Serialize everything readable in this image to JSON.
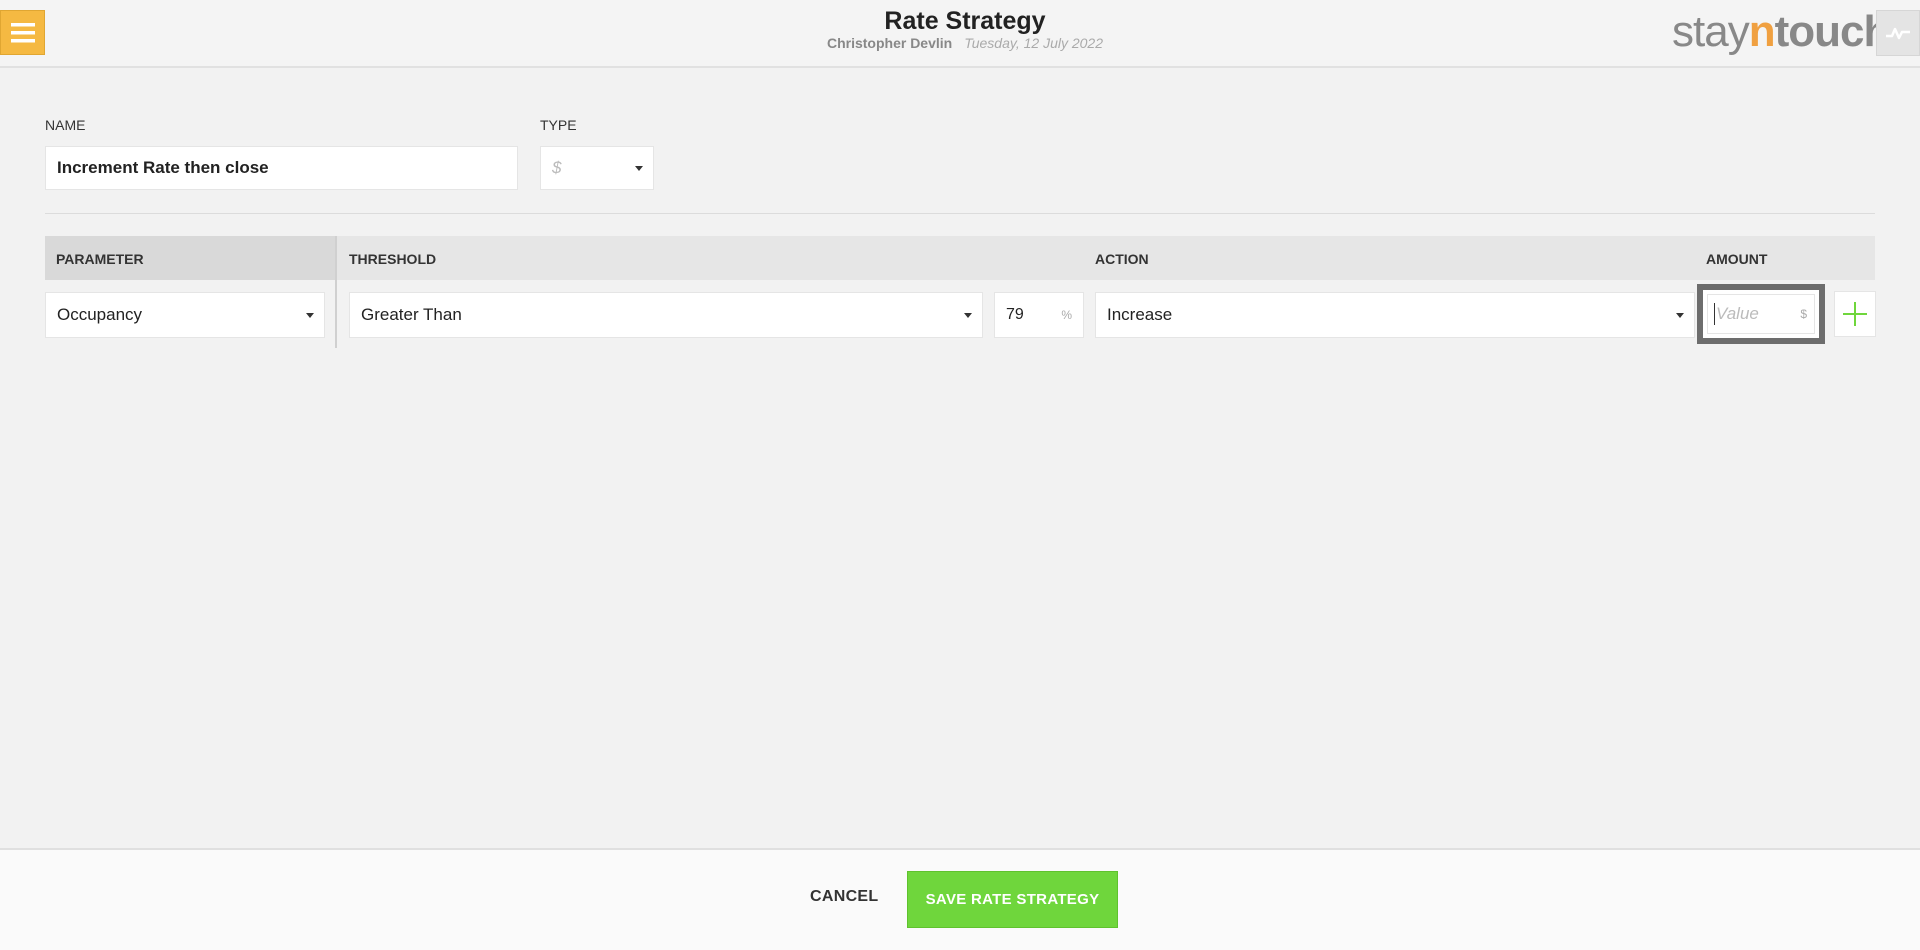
{
  "header": {
    "title": "Rate Strategy",
    "user": "Christopher Devlin",
    "date": "Tuesday, 12 July 2022",
    "logo": {
      "part1": "stay",
      "part2": "n",
      "part3": "touch"
    }
  },
  "form": {
    "name_label": "NAME",
    "name_value": "Increment Rate then close",
    "type_label": "TYPE",
    "type_value": "$"
  },
  "table": {
    "headers": {
      "parameter": "PARAMETER",
      "threshold": "THRESHOLD",
      "action": "ACTION",
      "amount": "AMOUNT"
    },
    "row": {
      "parameter": "Occupancy",
      "threshold_operator": "Greater Than",
      "threshold_value": "79",
      "threshold_unit": "%",
      "action": "Increase",
      "amount_placeholder": "Value",
      "amount_unit": "$"
    }
  },
  "footer": {
    "cancel_label": "CANCEL",
    "save_label": "SAVE RATE STRATEGY"
  },
  "colors": {
    "menu_button": "#f5b942",
    "logo_accent": "#f0a040",
    "save_button": "#6fd63c",
    "add_icon": "#6fd63c"
  },
  "icons": [
    "menu-icon",
    "activity-icon",
    "chevron-down-icon",
    "plus-icon"
  ]
}
